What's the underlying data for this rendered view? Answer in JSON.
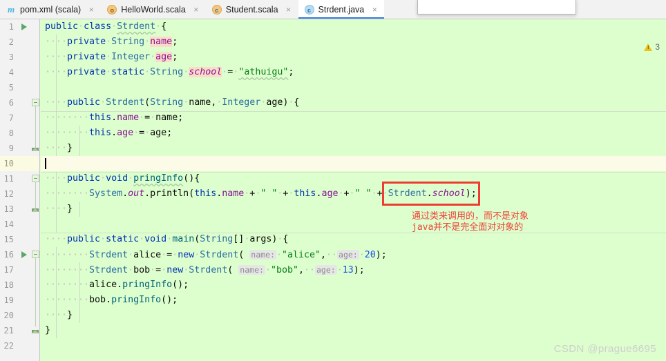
{
  "window": {
    "theme_background": "#ddfecd",
    "gutter_background": "#f2f2f2",
    "accent": "#3b7ddd"
  },
  "tabs": [
    {
      "label": "pom.xml (scala)",
      "icon": "maven-icon",
      "icon_letter": "m",
      "active": false,
      "close": "×"
    },
    {
      "label": "HelloWorld.scala",
      "icon": "scala-object-icon",
      "icon_letter": "o",
      "active": false,
      "close": "×"
    },
    {
      "label": "Student.scala",
      "icon": "scala-class-icon",
      "icon_letter": "c",
      "active": false,
      "close": "×"
    },
    {
      "label": "Strdent.java",
      "icon": "java-class-icon",
      "icon_letter": "c",
      "active": true,
      "close": "×"
    }
  ],
  "inspection": {
    "icon": "warning-triangle-icon",
    "count": "3"
  },
  "editor": {
    "file": "Strdent.java",
    "cursor_line": 10,
    "lines": [
      {
        "n": "1",
        "run": true,
        "text": "public class Strdent {"
      },
      {
        "n": "2",
        "run": false,
        "text": "    private String name;"
      },
      {
        "n": "3",
        "run": false,
        "text": "    private Integer age;"
      },
      {
        "n": "4",
        "run": false,
        "text": "    private static String school = \"athuigu\";"
      },
      {
        "n": "5",
        "run": false,
        "text": ""
      },
      {
        "n": "6",
        "run": false,
        "text": "    public Strdent(String name, Integer age) {"
      },
      {
        "n": "7",
        "run": false,
        "text": "        this.name = name;"
      },
      {
        "n": "8",
        "run": false,
        "text": "        this.age = age;"
      },
      {
        "n": "9",
        "run": false,
        "text": "    }"
      },
      {
        "n": "10",
        "run": false,
        "text": ""
      },
      {
        "n": "11",
        "run": false,
        "text": "    public void pringInfo(){"
      },
      {
        "n": "12",
        "run": false,
        "text": "        System.out.println(this.name + \" \" + this.age + \" \" + Strdent.school);"
      },
      {
        "n": "13",
        "run": false,
        "text": "    }"
      },
      {
        "n": "14",
        "run": false,
        "text": ""
      },
      {
        "n": "15",
        "run": true,
        "text": "    public static void main(String[] args) {"
      },
      {
        "n": "16",
        "run": false,
        "text": "        Strdent alice = new Strdent( name: \"alice\",  age: 20);"
      },
      {
        "n": "17",
        "run": false,
        "text": "        Strdent bob = new Strdent( name: \"bob\",  age: 13);"
      },
      {
        "n": "18",
        "run": false,
        "text": "        alice.pringInfo();"
      },
      {
        "n": "19",
        "run": false,
        "text": "        bob.pringInfo();"
      },
      {
        "n": "20",
        "run": false,
        "text": "    }"
      },
      {
        "n": "21",
        "run": false,
        "text": "}"
      },
      {
        "n": "22",
        "run": false,
        "text": ""
      }
    ],
    "param_hints": {
      "name": "name:",
      "age": "age:"
    }
  },
  "annotation": {
    "box_color": "#ee3b33",
    "highlighted_code": "Strdent.school);",
    "text_color": "#ef4136",
    "line1": "通过类来调用的，而不是对象",
    "line2": "java并不是完全面对对象的"
  },
  "watermark": {
    "text": "CSDN @prague6695"
  }
}
